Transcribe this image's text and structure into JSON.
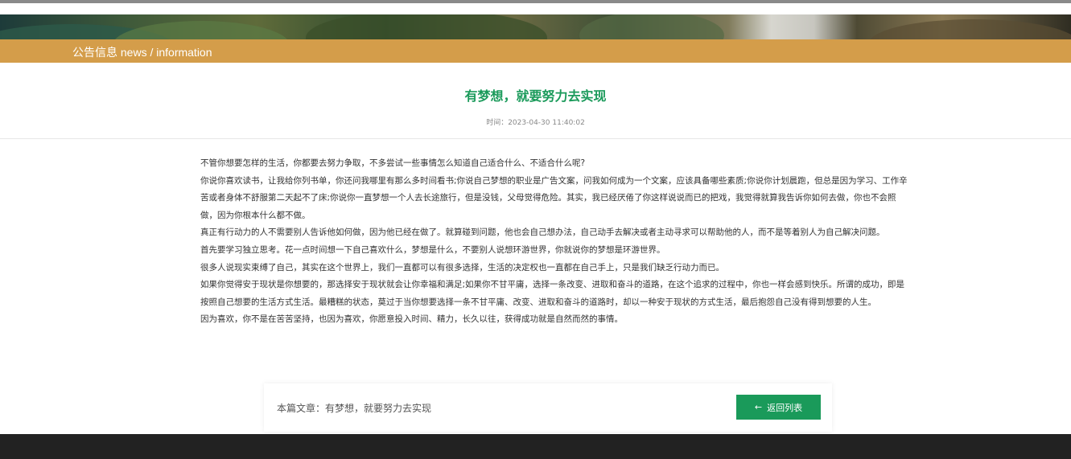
{
  "category": {
    "label": "公告信息 news / information"
  },
  "article": {
    "title": "有梦想，就要努力去实现",
    "time_label": "时间：2023-04-30 11:40:02",
    "paragraphs": [
      "不管你想要怎样的生活，你都要去努力争取，不多尝试一些事情怎么知道自己适合什么、不适合什么呢?",
      "你说你喜欢读书，让我给你列书单，你还问我哪里有那么多时间看书;你说自己梦想的职业是广告文案，问我如何成为一个文案，应该具备哪些素质;你说你计划晨跑，但总是因为学习、工作辛苦或者身体不舒服第二天起不了床;你说你一直梦想一个人去长途旅行，但是没钱，父母觉得危险。其实，我已经厌倦了你这样说说而已的把戏，我觉得就算我告诉你如何去做，你也不会照做，因为你根本什么都不做。",
      "真正有行动力的人不需要别人告诉他如何做，因为他已经在做了。就算碰到问题，他也会自己想办法，自己动手去解决或者主动寻求可以帮助他的人，而不是等着别人为自己解决问题。",
      "首先要学习独立思考。花一点时间想一下自己喜欢什么，梦想是什么，不要别人说想环游世界，你就说你的梦想是环游世界。",
      "很多人说现实束缚了自己，其实在这个世界上，我们一直都可以有很多选择，生活的决定权也一直都在自己手上，只是我们缺乏行动力而已。",
      "如果你觉得安于现状是你想要的，那选择安于现状就会让你幸福和满足;如果你不甘平庸，选择一条改变、进取和奋斗的道路，在这个追求的过程中，你也一样会感到快乐。所谓的成功，即是按照自己想要的生活方式生活。最糟糕的状态，莫过于当你想要选择一条不甘平庸、改变、进取和奋斗的道路时，却以一种安于现状的方式生活，最后抱怨自己没有得到想要的人生。",
      "因为喜欢，你不是在苦苦坚持，也因为喜欢，你愿意投入时间、精力，长久以往，获得成功就是自然而然的事情。"
    ]
  },
  "footer": {
    "current_article": "本篇文章：有梦想，就要努力去实现",
    "back_label": "返回列表",
    "back_icon": "arrow-left-icon"
  },
  "colors": {
    "accent_green": "#1a9a5a",
    "category_bar": "#d49d4a"
  }
}
